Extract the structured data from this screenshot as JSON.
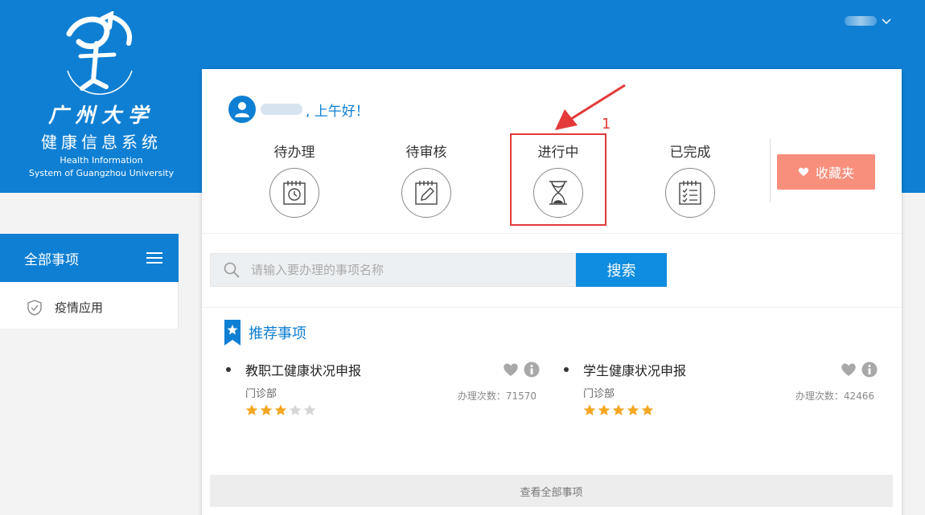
{
  "logo": {
    "cn_line1": "广州大学",
    "cn_line2": "健康信息系统",
    "en_line1": "Health Information",
    "en_line2": "System of Guangzhou University"
  },
  "greeting": {
    "text": ", 上午好！"
  },
  "status_items": [
    {
      "label": "待办理",
      "icon": "calendar-clock-icon"
    },
    {
      "label": "待审核",
      "icon": "calendar-edit-icon"
    },
    {
      "label": "进行中",
      "icon": "hourglass-icon"
    },
    {
      "label": "已完成",
      "icon": "checklist-icon"
    }
  ],
  "favorites_label": "收藏夹",
  "sidebar": {
    "header": "全部事项",
    "items": [
      {
        "label": "疫情应用",
        "icon": "shield-icon"
      }
    ]
  },
  "search": {
    "placeholder": "请输入要办理的事项名称",
    "button": "搜索"
  },
  "recommended": {
    "title": "推荐事项",
    "items": [
      {
        "title": "教职工健康状况申报",
        "dept": "门诊部",
        "count": "办理次数：71570",
        "rating": 3,
        "max_rating": 5
      },
      {
        "title": "学生健康状况申报",
        "dept": "门诊部",
        "count": "办理次数：42466",
        "rating": 5,
        "max_rating": 5
      }
    ]
  },
  "view_all": "查看全部事项",
  "annotation": {
    "number": "1"
  },
  "colors": {
    "primary": "#0f7fd3",
    "accent": "#f88f7c",
    "annotation": "#e43a3a",
    "star": "#f5a623"
  }
}
